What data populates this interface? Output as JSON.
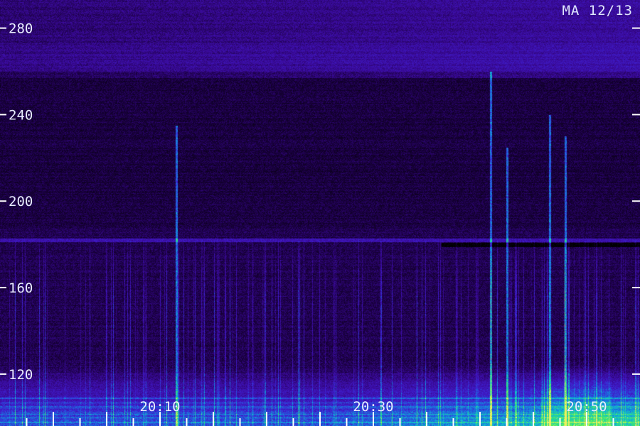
{
  "chart_data": {
    "type": "heatmap",
    "title": "MA 12/13",
    "xlabel": "",
    "ylabel": "",
    "x_ticks": [
      "20:10",
      "20:30",
      "20:50"
    ],
    "y_ticks": [
      120,
      160,
      200,
      240,
      280
    ],
    "y_range": [
      96,
      293
    ],
    "x_range_minutes": [
      0,
      60
    ],
    "x_tick_positions_minutes": [
      15,
      35,
      55
    ],
    "grid": false,
    "colormap": [
      "#000000",
      "#1a0040",
      "#3a0a9a",
      "#3f1fd0",
      "#1a70e0",
      "#10c0d0",
      "#40ee60",
      "#eef060"
    ],
    "features": {
      "band_line_value": 182,
      "low_noise_ceiling": 125,
      "strong_bursts_minutes": [
        16.5,
        46,
        47.5,
        51.5,
        53
      ],
      "burst_upper_values": [
        235,
        260,
        225,
        240,
        230
      ]
    },
    "accent": "#ffffff"
  }
}
